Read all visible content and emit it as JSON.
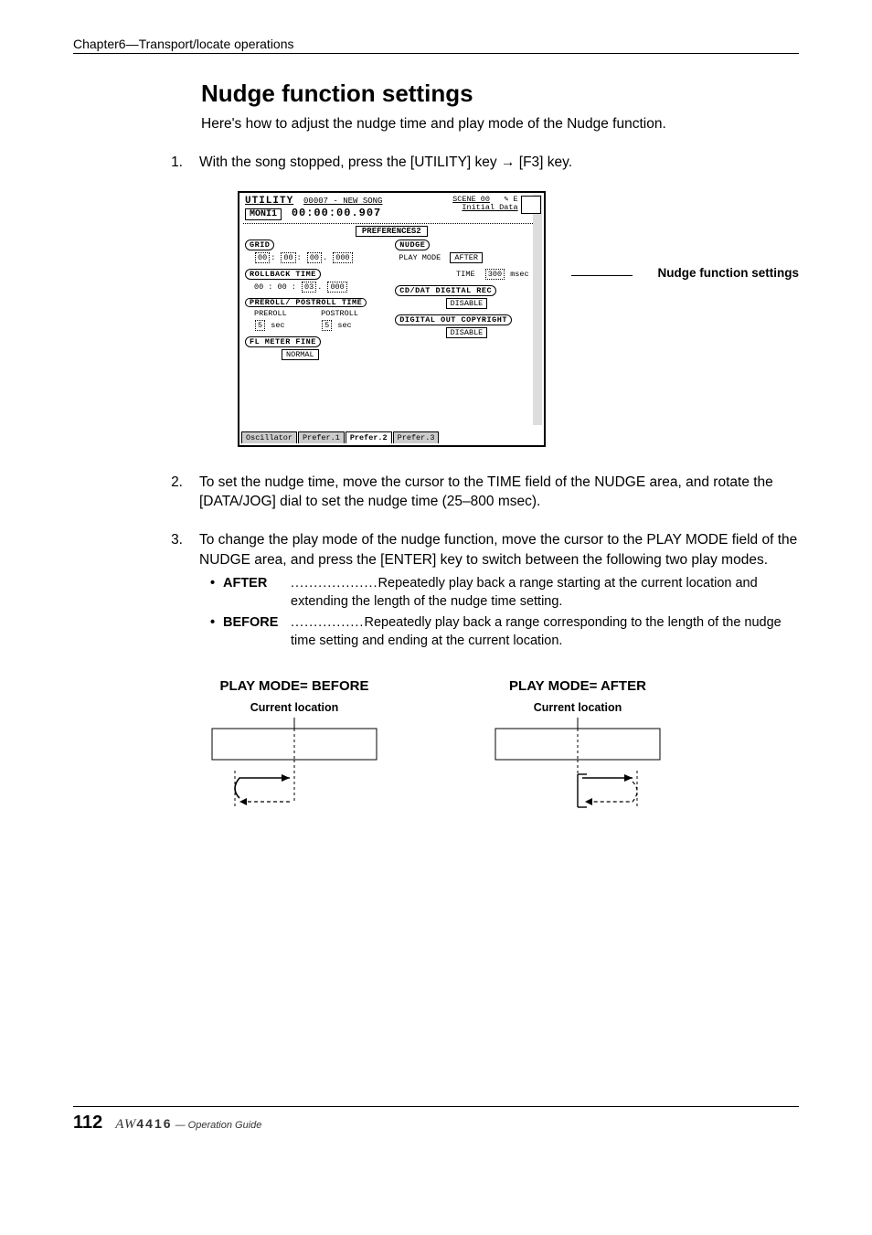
{
  "chapter_header": "Chapter6—Transport/locate operations",
  "section_title": "Nudge function settings",
  "intro": "Here's how to adjust the nudge time and play mode of the Nudge function.",
  "steps": {
    "s1": {
      "num": "1.",
      "text": "With the song stopped, press the [UTILITY] key → [F3] key."
    },
    "s2": {
      "num": "2.",
      "text": "To set the nudge time, move the cursor to the TIME field of the NUDGE area, and rotate the [DATA/JOG] dial to set the nudge time (25–800 msec)."
    },
    "s3": {
      "num": "3.",
      "text": "To change the play mode of the nudge function, move the cursor to the PLAY MODE field of the NUDGE area, and press the [ENTER] key to switch between the following two play modes."
    }
  },
  "callout": "Nudge function settings",
  "screenshot": {
    "title": "UTILITY",
    "song": "00007 - NEW SONG",
    "time": "00:00:00.907",
    "moni": "MONI1",
    "scene": "SCENE 00",
    "init": "Initial Data",
    "icons": "✎ E",
    "preferences": "PREFERENCES2",
    "grid_label": "GRID",
    "grid_value_h": "00",
    "grid_value_m": "00",
    "grid_value_s": "00",
    "grid_value_ms": "000",
    "rollback_label": "ROLLBACK TIME",
    "rollback_value": "00 : 00 :",
    "rollback_s": "03",
    "rollback_ms": "000",
    "prepost_label": "PREROLL/ POSTROLL TIME",
    "preroll": "PREROLL",
    "postroll": "POSTROLL",
    "preroll_v": "5",
    "postroll_v": "5",
    "sec": "sec",
    "meter_label": "FL METER FINE",
    "meter_value": "NORMAL",
    "nudge_label": "NUDGE",
    "playmode": "PLAY MODE",
    "playmode_v": "AFTER",
    "time_label": "TIME",
    "time_v": "300",
    "msec": "msec",
    "cddat_label": "CD/DAT DIGITAL REC",
    "disable": "DISABLE",
    "copyright_label": "DIGITAL OUT COPYRIGHT",
    "tabs": {
      "t1": "Oscillator",
      "t2": "Prefer.1",
      "t3": "Prefer.2",
      "t4": "Prefer.3"
    }
  },
  "bullets": {
    "after_label": "AFTER",
    "after_dots": "...................",
    "after_text": "Repeatedly play back a range starting at the current location and extending the length of the nudge time setting.",
    "before_label": "BEFORE",
    "before_dots": "................",
    "before_text": "Repeatedly play back a range corresponding to the length of the nudge time setting and ending at the current location."
  },
  "diagrams": {
    "before_title": "PLAY MODE= BEFORE",
    "after_title": "PLAY MODE= AFTER",
    "current_location": "Current location"
  },
  "footer": {
    "page": "112",
    "model_prefix": "AW",
    "model_num": "4416",
    "guide": "— Operation Guide"
  }
}
